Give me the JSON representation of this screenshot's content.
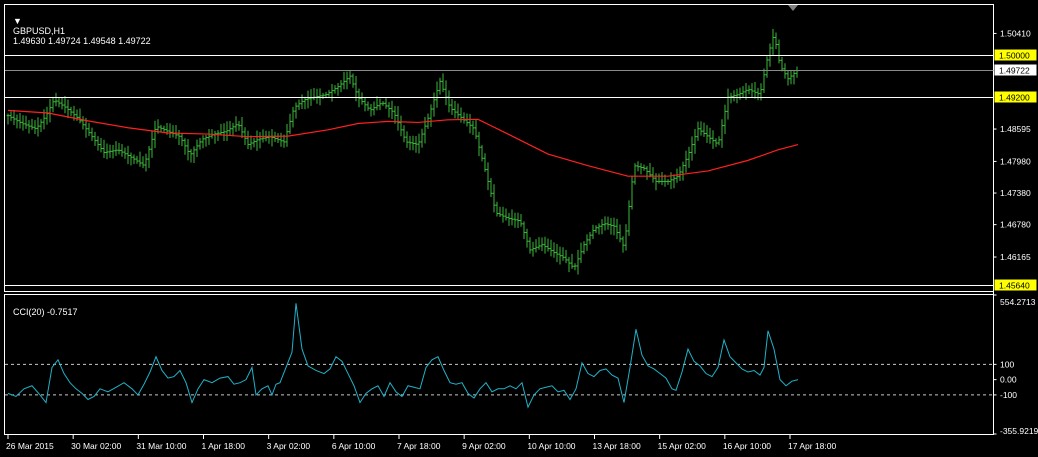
{
  "header": {
    "symbol": "GBPUSD,H1",
    "ohlc": "1.49630 1.49724 1.49548 1.49722"
  },
  "indicator": {
    "label": "CCI(20) -0.7517"
  },
  "colors": {
    "background": "#000000",
    "bars": "#3cb83c",
    "moving_average": "#ff2020",
    "cci_line": "#20b2c8",
    "horizontal_line": "#ffffff",
    "price_tag_bg": "#ffff00",
    "current_tag_bg": "#ffffff",
    "grid_frame": "#ffffff"
  },
  "chart_data": [
    {
      "type": "line",
      "subtype": "bar-ohlc",
      "symbol": "GBPUSD",
      "timeframe": "H1",
      "grid": false,
      "price_axis_labels": [
        "1.50410",
        "1.48595",
        "1.47980",
        "1.47380",
        "1.46780",
        "1.46165"
      ],
      "ylim": [
        1.4552,
        1.5095
      ],
      "horizontal_lines": [
        {
          "value": 1.5,
          "label": "1.50000",
          "tag": "yellow"
        },
        {
          "value": 1.49722,
          "label": "1.49722",
          "tag": "white"
        },
        {
          "value": 1.492,
          "label": "1.49200",
          "tag": "yellow"
        },
        {
          "value": 1.4564,
          "label": "1.45640",
          "tag": "yellow"
        }
      ],
      "x_tick_labels": [
        "26 Mar 2015",
        "30 Mar 02:00",
        "31 Mar 10:00",
        "1 Apr 18:00",
        "3 Apr 02:00",
        "6 Apr 10:00",
        "7 Apr 18:00",
        "9 Apr 02:00",
        "10 Apr 10:00",
        "13 Apr 18:00",
        "15 Apr 02:00",
        "16 Apr 10:00",
        "17 Apr 18:00"
      ],
      "close_path": [
        [
          0,
          1.4885
        ],
        [
          14,
          1.487
        ],
        [
          28,
          1.486
        ],
        [
          38,
          1.4885
        ],
        [
          46,
          1.4915
        ],
        [
          58,
          1.49
        ],
        [
          70,
          1.488
        ],
        [
          84,
          1.4845
        ],
        [
          96,
          1.4815
        ],
        [
          110,
          1.482
        ],
        [
          124,
          1.4805
        ],
        [
          136,
          1.479
        ],
        [
          148,
          1.4865
        ],
        [
          160,
          1.4855
        ],
        [
          172,
          1.4845
        ],
        [
          182,
          1.481
        ],
        [
          194,
          1.484
        ],
        [
          206,
          1.485
        ],
        [
          218,
          1.4855
        ],
        [
          230,
          1.487
        ],
        [
          240,
          1.483
        ],
        [
          250,
          1.484
        ],
        [
          262,
          1.4845
        ],
        [
          276,
          1.4835
        ],
        [
          286,
          1.49
        ],
        [
          296,
          1.4915
        ],
        [
          306,
          1.492
        ],
        [
          318,
          1.4925
        ],
        [
          330,
          1.494
        ],
        [
          342,
          1.496
        ],
        [
          350,
          1.492
        ],
        [
          362,
          1.4895
        ],
        [
          374,
          1.491
        ],
        [
          386,
          1.489
        ],
        [
          398,
          1.4835
        ],
        [
          410,
          1.483
        ],
        [
          420,
          1.488
        ],
        [
          432,
          1.495
        ],
        [
          442,
          1.49
        ],
        [
          454,
          1.488
        ],
        [
          466,
          1.486
        ],
        [
          476,
          1.479
        ],
        [
          488,
          1.47
        ],
        [
          500,
          1.469
        ],
        [
          512,
          1.4685
        ],
        [
          522,
          1.463
        ],
        [
          534,
          1.464
        ],
        [
          546,
          1.4625
        ],
        [
          556,
          1.4615
        ],
        [
          566,
          1.4595
        ],
        [
          576,
          1.464
        ],
        [
          586,
          1.467
        ],
        [
          596,
          1.468
        ],
        [
          606,
          1.4675
        ],
        [
          616,
          1.4635
        ],
        [
          626,
          1.479
        ],
        [
          636,
          1.4785
        ],
        [
          648,
          1.476
        ],
        [
          660,
          1.476
        ],
        [
          670,
          1.477
        ],
        [
          680,
          1.481
        ],
        [
          690,
          1.486
        ],
        [
          700,
          1.4845
        ],
        [
          710,
          1.483
        ],
        [
          720,
          1.492
        ],
        [
          730,
          1.4925
        ],
        [
          740,
          1.4935
        ],
        [
          752,
          1.4925
        ],
        [
          760,
          1.5
        ],
        [
          766,
          1.504
        ],
        [
          772,
          1.498
        ],
        [
          780,
          1.4955
        ],
        [
          790,
          1.4972
        ]
      ],
      "moving_average_path": [
        [
          0,
          1.4895
        ],
        [
          40,
          1.489
        ],
        [
          80,
          1.4875
        ],
        [
          120,
          1.4862
        ],
        [
          160,
          1.4852
        ],
        [
          200,
          1.485
        ],
        [
          240,
          1.4845
        ],
        [
          280,
          1.4846
        ],
        [
          320,
          1.4858
        ],
        [
          350,
          1.487
        ],
        [
          380,
          1.4874
        ],
        [
          410,
          1.4872
        ],
        [
          440,
          1.4877
        ],
        [
          470,
          1.4878
        ],
        [
          500,
          1.485
        ],
        [
          540,
          1.4812
        ],
        [
          580,
          1.479
        ],
        [
          620,
          1.477
        ],
        [
          660,
          1.477
        ],
        [
          700,
          1.478
        ],
        [
          740,
          1.48
        ],
        [
          770,
          1.482
        ],
        [
          790,
          1.483
        ]
      ]
    },
    {
      "type": "line",
      "name": "CCI(20)",
      "last_value": -0.7517,
      "grid": false,
      "axis_labels": [
        "554.2713",
        "100",
        "0.00",
        "-100",
        "-355.9219"
      ],
      "ylim": [
        -355.9219,
        554.2713
      ],
      "levels": [
        100,
        0,
        -100
      ],
      "path": [
        [
          0,
          -90
        ],
        [
          8,
          -110
        ],
        [
          16,
          -60
        ],
        [
          24,
          -40
        ],
        [
          32,
          -100
        ],
        [
          38,
          -150
        ],
        [
          44,
          80
        ],
        [
          50,
          130
        ],
        [
          56,
          40
        ],
        [
          62,
          -20
        ],
        [
          68,
          -60
        ],
        [
          74,
          -90
        ],
        [
          80,
          -130
        ],
        [
          86,
          -110
        ],
        [
          92,
          -60
        ],
        [
          100,
          -80
        ],
        [
          108,
          -50
        ],
        [
          116,
          -20
        ],
        [
          124,
          -60
        ],
        [
          130,
          -100
        ],
        [
          136,
          -30
        ],
        [
          142,
          50
        ],
        [
          148,
          150
        ],
        [
          154,
          60
        ],
        [
          160,
          10
        ],
        [
          166,
          20
        ],
        [
          172,
          60
        ],
        [
          178,
          -20
        ],
        [
          184,
          -150
        ],
        [
          190,
          -60
        ],
        [
          196,
          0
        ],
        [
          204,
          -20
        ],
        [
          212,
          10
        ],
        [
          220,
          20
        ],
        [
          226,
          -30
        ],
        [
          232,
          -20
        ],
        [
          238,
          0
        ],
        [
          244,
          80
        ],
        [
          248,
          -100
        ],
        [
          254,
          -60
        ],
        [
          260,
          -40
        ],
        [
          264,
          -100
        ],
        [
          268,
          -30
        ],
        [
          272,
          -20
        ],
        [
          278,
          80
        ],
        [
          284,
          180
        ],
        [
          288,
          500
        ],
        [
          294,
          200
        ],
        [
          300,
          90
        ],
        [
          308,
          60
        ],
        [
          316,
          40
        ],
        [
          322,
          70
        ],
        [
          328,
          150
        ],
        [
          334,
          120
        ],
        [
          340,
          40
        ],
        [
          346,
          -40
        ],
        [
          352,
          -150
        ],
        [
          358,
          -90
        ],
        [
          364,
          -60
        ],
        [
          370,
          -40
        ],
        [
          376,
          -110
        ],
        [
          382,
          -20
        ],
        [
          388,
          -80
        ],
        [
          394,
          -110
        ],
        [
          400,
          -40
        ],
        [
          406,
          -50
        ],
        [
          412,
          -60
        ],
        [
          418,
          80
        ],
        [
          424,
          130
        ],
        [
          430,
          150
        ],
        [
          436,
          60
        ],
        [
          442,
          -20
        ],
        [
          448,
          -30
        ],
        [
          454,
          -20
        ],
        [
          460,
          -90
        ],
        [
          466,
          -120
        ],
        [
          472,
          -60
        ],
        [
          478,
          -20
        ],
        [
          484,
          -80
        ],
        [
          490,
          -60
        ],
        [
          496,
          -60
        ],
        [
          502,
          -40
        ],
        [
          508,
          -60
        ],
        [
          514,
          -20
        ],
        [
          520,
          -180
        ],
        [
          526,
          -100
        ],
        [
          532,
          -60
        ],
        [
          538,
          -50
        ],
        [
          544,
          -40
        ],
        [
          550,
          -80
        ],
        [
          556,
          -70
        ],
        [
          562,
          -130
        ],
        [
          568,
          -60
        ],
        [
          574,
          110
        ],
        [
          580,
          40
        ],
        [
          586,
          20
        ],
        [
          592,
          60
        ],
        [
          598,
          70
        ],
        [
          604,
          30
        ],
        [
          610,
          10
        ],
        [
          616,
          -150
        ],
        [
          622,
          80
        ],
        [
          628,
          330
        ],
        [
          634,
          160
        ],
        [
          640,
          90
        ],
        [
          646,
          70
        ],
        [
          652,
          40
        ],
        [
          658,
          10
        ],
        [
          664,
          -60
        ],
        [
          668,
          -70
        ],
        [
          674,
          50
        ],
        [
          680,
          200
        ],
        [
          686,
          120
        ],
        [
          692,
          90
        ],
        [
          698,
          40
        ],
        [
          704,
          20
        ],
        [
          710,
          80
        ],
        [
          716,
          260
        ],
        [
          722,
          150
        ],
        [
          728,
          110
        ],
        [
          734,
          70
        ],
        [
          740,
          50
        ],
        [
          746,
          60
        ],
        [
          752,
          30
        ],
        [
          756,
          80
        ],
        [
          760,
          320
        ],
        [
          766,
          200
        ],
        [
          772,
          0
        ],
        [
          778,
          -40
        ],
        [
          784,
          -10
        ],
        [
          790,
          0
        ]
      ]
    }
  ]
}
